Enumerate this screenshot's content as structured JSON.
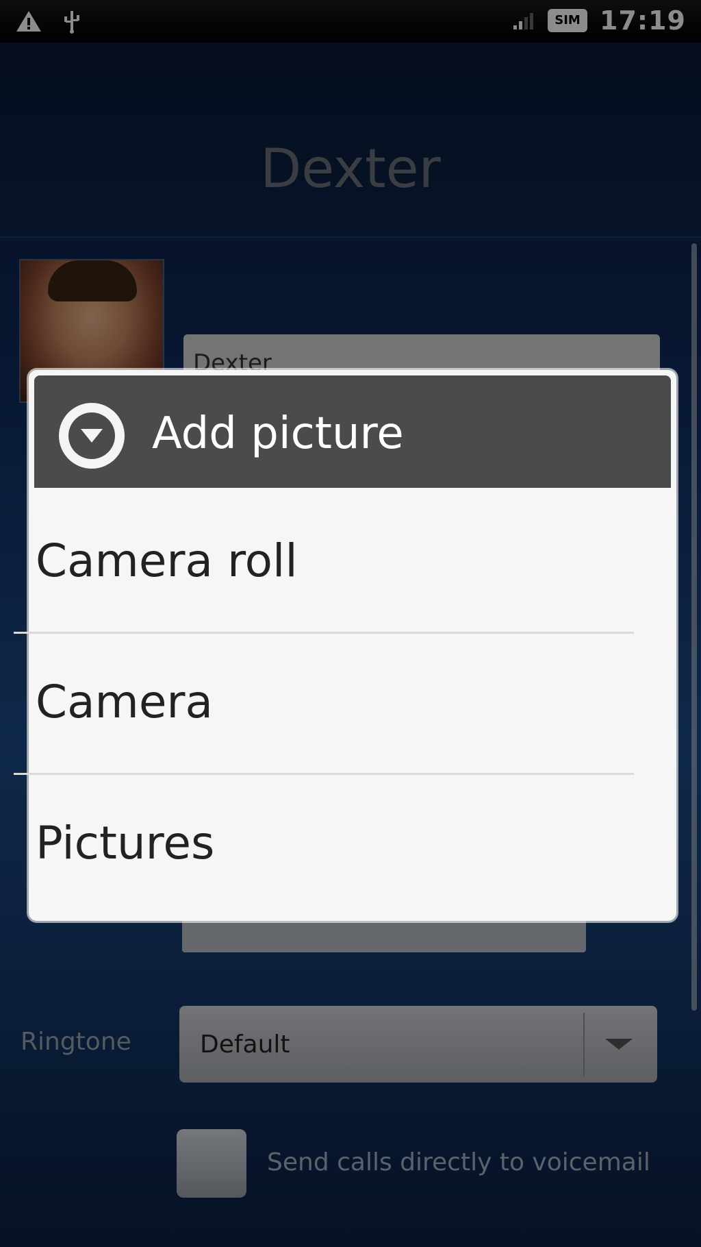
{
  "status_bar": {
    "time": "17:19",
    "left_icons": [
      "warning-icon",
      "usb-icon"
    ],
    "right_icons": [
      "signal-icon",
      "sim-icon"
    ],
    "sim_label": "SIM"
  },
  "header": {
    "title": "Dexter"
  },
  "editor": {
    "name_field_value": "Dexter",
    "ringtone_label": "Ringtone",
    "ringtone_value": "Default",
    "voicemail_label": "Send calls directly to voicemail"
  },
  "dialog": {
    "title": "Add picture",
    "icon": "dropdown-circle-icon",
    "options": [
      {
        "label": "Camera roll"
      },
      {
        "label": "Camera"
      },
      {
        "label": "Pictures"
      }
    ]
  }
}
